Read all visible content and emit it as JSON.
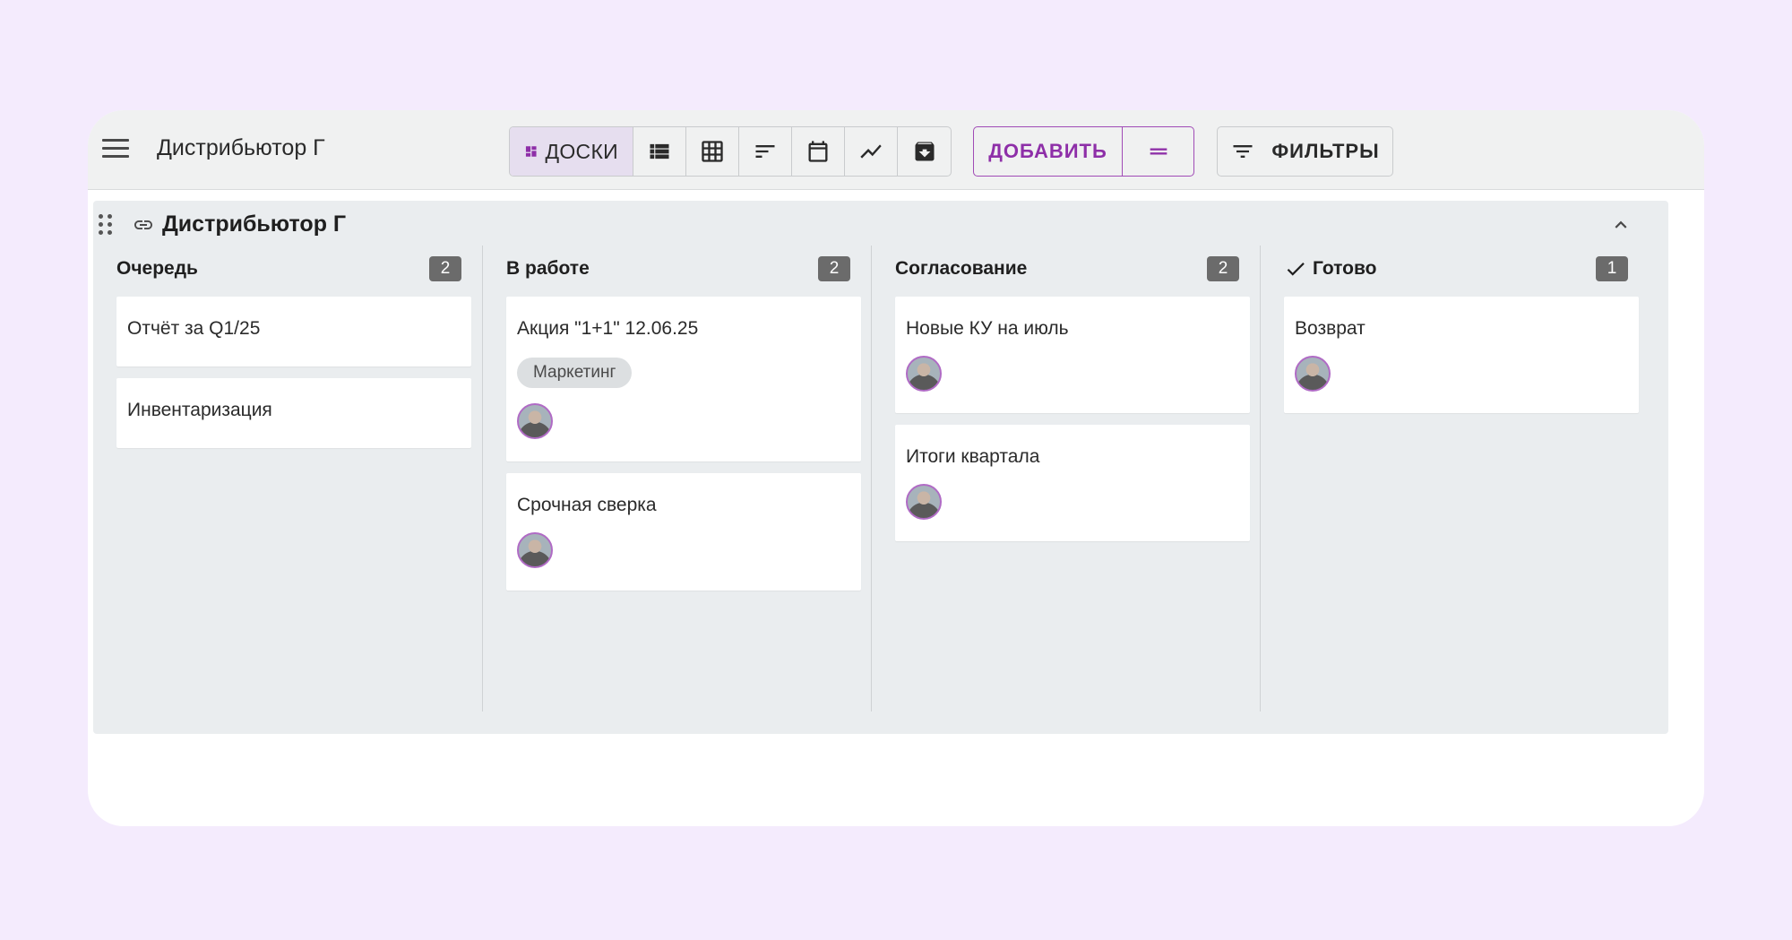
{
  "header": {
    "title": "Дистрибьютор Г",
    "views": [
      {
        "name": "boards",
        "label": "ДОСКИ",
        "icon": "dashboard-icon",
        "active": true
      },
      {
        "name": "list",
        "icon": "list-icon"
      },
      {
        "name": "table",
        "icon": "grid-icon"
      },
      {
        "name": "gantt",
        "icon": "sort-icon"
      },
      {
        "name": "calendar",
        "icon": "calendar-icon"
      },
      {
        "name": "chart",
        "icon": "trend-icon"
      },
      {
        "name": "archive",
        "icon": "archive-icon"
      }
    ],
    "add_label": "ДОБАВИТЬ",
    "filters_label": "ФИЛЬТРЫ"
  },
  "board": {
    "title": "Дистрибьютор Г",
    "columns": [
      {
        "title": "Очередь",
        "count": "2",
        "cards": [
          {
            "title": "Отчёт за Q1/25"
          },
          {
            "title": "Инвентаризация"
          }
        ]
      },
      {
        "title": "В работе",
        "count": "2",
        "cards": [
          {
            "title": "Акция \"1+1\" 12.06.25",
            "tag": "Маркетинг"
          },
          {
            "title": "Срочная сверка"
          }
        ]
      },
      {
        "title": "Согласование",
        "count": "2",
        "cards": [
          {
            "title": "Новые КУ на июль"
          },
          {
            "title": "Итоги квартала"
          }
        ]
      },
      {
        "title": "Готово",
        "count": "1",
        "cards": [
          {
            "title": "Возврат"
          }
        ]
      }
    ]
  },
  "colors": {
    "accent": "#8e2fa8",
    "page_bg": "#f4ebfd",
    "board_bg": "#eaedef"
  }
}
